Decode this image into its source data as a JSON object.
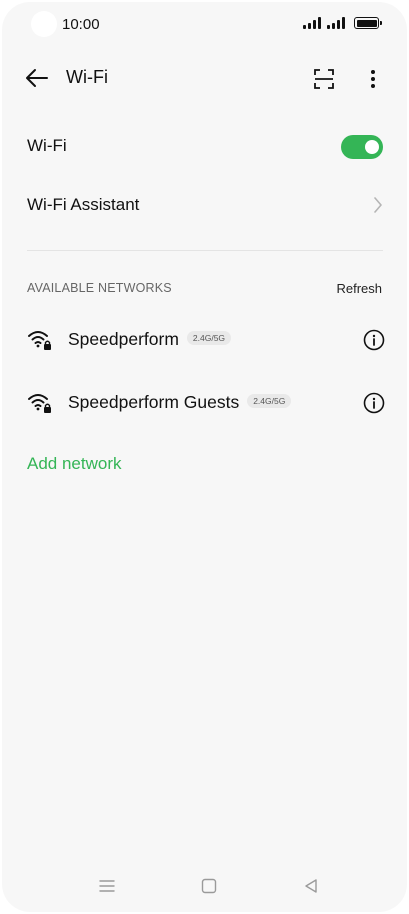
{
  "status_bar": {
    "time": "10:00",
    "icons": [
      "signal-icon",
      "signal-icon",
      "battery-icon"
    ]
  },
  "header": {
    "title": "Wi-Fi",
    "back_icon": "back-arrow-icon",
    "scan_icon": "qr-scan-icon",
    "more_icon": "more-vertical-icon"
  },
  "settings": {
    "wifi_label": "Wi-Fi",
    "wifi_enabled": true,
    "assistant_label": "Wi-Fi Assistant"
  },
  "networks_section": {
    "header": "AVAILABLE NETWORKS",
    "refresh_label": "Refresh",
    "networks": [
      {
        "name": "Speedperform",
        "band": "2.4G/5G",
        "secured": true
      },
      {
        "name": "Speedperform Guests",
        "band": "2.4G/5G",
        "secured": true
      }
    ],
    "add_network_label": "Add network"
  },
  "nav_bar": {
    "icons": [
      "menu-icon",
      "home-icon",
      "back-triangle-icon"
    ]
  },
  "colors": {
    "accent": "#34b556",
    "background": "#f7f7f7",
    "text": "#111111",
    "muted": "#666666"
  }
}
